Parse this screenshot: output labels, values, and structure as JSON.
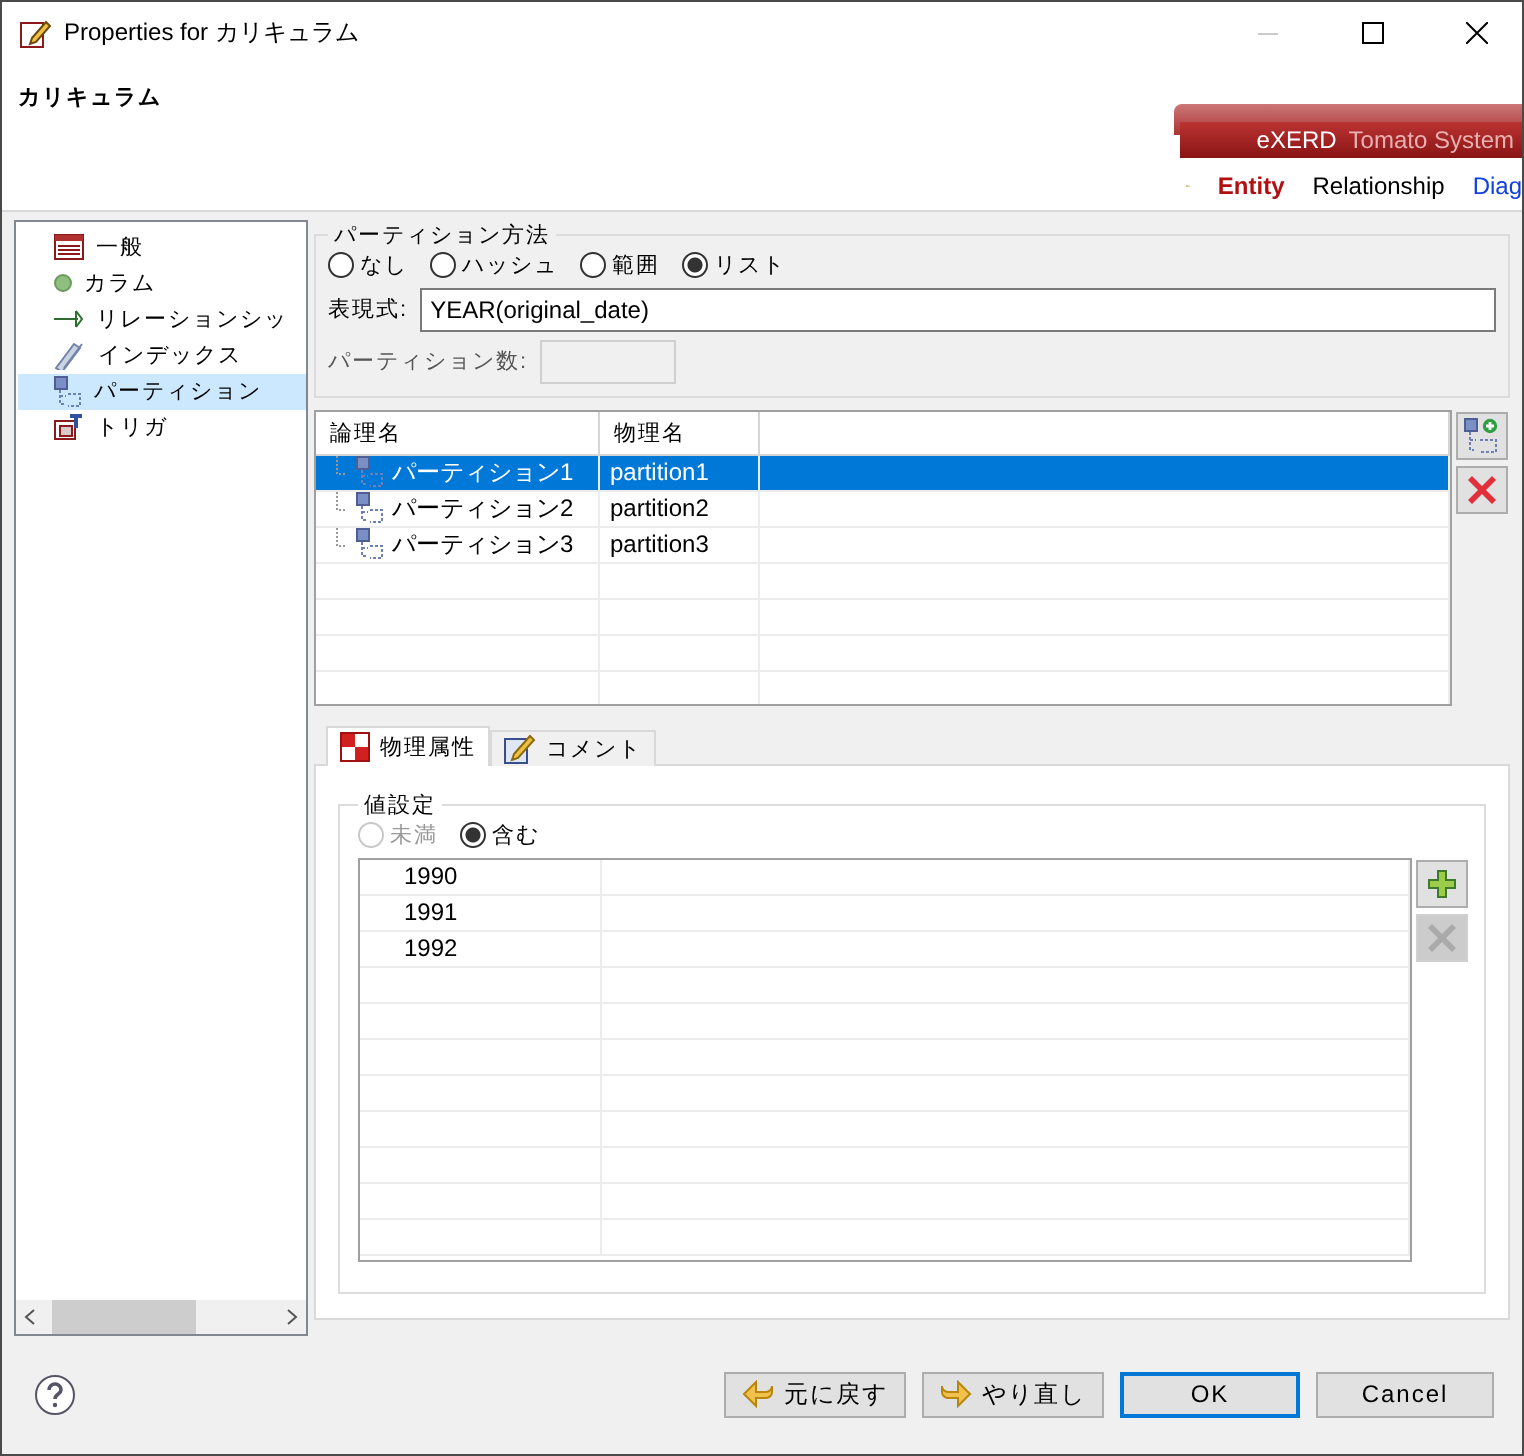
{
  "window": {
    "title": "Properties for カリキュラム"
  },
  "header": {
    "title": "カリキュラム"
  },
  "banner": {
    "product": "eXERD",
    "edition": "Tomato System",
    "tabs": [
      {
        "label": "Entity",
        "selected": true
      },
      {
        "label": "Relationship",
        "selected": false
      },
      {
        "label": "Diag",
        "selected": false
      }
    ]
  },
  "tree": [
    {
      "label": "一般",
      "kind": "table",
      "selected": false
    },
    {
      "label": "カラム",
      "kind": "column",
      "selected": false
    },
    {
      "label": "リレーションシッ",
      "kind": "relation",
      "selected": false
    },
    {
      "label": "インデックス",
      "kind": "index",
      "selected": false
    },
    {
      "label": "パーティション",
      "kind": "partition",
      "selected": true
    },
    {
      "label": "トリガ",
      "kind": "trigger",
      "selected": false
    }
  ],
  "partition_method": {
    "legend": "パーティション方法",
    "options": [
      {
        "label": "なし",
        "selected": false
      },
      {
        "label": "ハッシュ",
        "selected": false
      },
      {
        "label": "範囲",
        "selected": false
      },
      {
        "label": "リスト",
        "selected": true
      }
    ],
    "expression_label": "表現式:",
    "expression": "YEAR(original_date)",
    "count_label": "パーティション数:"
  },
  "partitions": {
    "columns": [
      "論理名",
      "物理名"
    ],
    "rows": [
      {
        "logical": "パーティション1",
        "physical": "partition1",
        "selected": true
      },
      {
        "logical": "パーティション2",
        "physical": "partition2",
        "selected": false
      },
      {
        "logical": "パーティション3",
        "physical": "partition3",
        "selected": false
      }
    ],
    "buttons": [
      {
        "kind": "add",
        "disabled": false
      },
      {
        "kind": "delete",
        "disabled": false
      }
    ]
  },
  "tabs": [
    {
      "label": "物理属性",
      "kind": "physical",
      "selected": true
    },
    {
      "label": "コメント",
      "kind": "comment",
      "selected": false
    }
  ],
  "value_settings": {
    "legend": "値設定",
    "options": [
      {
        "label": "未満",
        "selected": false,
        "disabled": true
      },
      {
        "label": "含む",
        "selected": true,
        "disabled": false
      }
    ],
    "values": [
      "1990",
      "1991",
      "1992"
    ],
    "buttons": [
      {
        "kind": "plus",
        "disabled": false
      },
      {
        "kind": "delete",
        "disabled": true
      }
    ]
  },
  "buttons": [
    {
      "label": "元に戻す",
      "kind": "undo",
      "default": false
    },
    {
      "label": "やり直し",
      "kind": "redo",
      "default": false
    },
    {
      "label": "OK",
      "kind": "plain",
      "default": true
    },
    {
      "label": "Cancel",
      "kind": "plain",
      "default": false
    }
  ]
}
